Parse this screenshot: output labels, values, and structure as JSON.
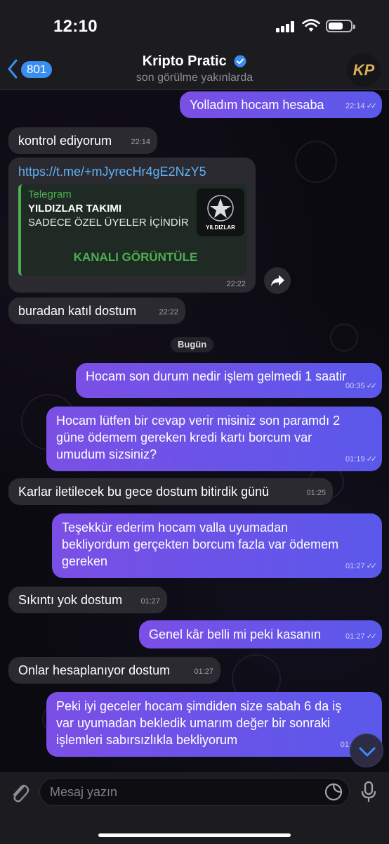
{
  "status_bar": {
    "time": "12:10"
  },
  "header": {
    "back_count": "801",
    "title": "Kripto Pratic",
    "subtitle": "son görülme yakınlarda",
    "avatar_text": "KP"
  },
  "messages": [
    {
      "dir": "out",
      "text": "Yolladım hocam hesaba",
      "time": "22:14"
    },
    {
      "dir": "in",
      "text": "kontrol ediyorum",
      "time": "22:14"
    },
    {
      "dir": "in",
      "text": "buradan katıl dostum",
      "time": "22:22"
    },
    {
      "dir": "out",
      "text": "Hocam son durum nedir işlem gelmedi 1 saatir",
      "time": "00:35"
    },
    {
      "dir": "out",
      "text": "Hocam lütfen bir cevap verir misiniz son paramdı 2 güne ödemem gereken kredi kartı borcum var umudum sizsiniz?",
      "time": "01:19"
    },
    {
      "dir": "in",
      "text": "Karlar iletilecek bu gece dostum bitirdik günü",
      "time": "01:25"
    },
    {
      "dir": "out",
      "text": "Teşekkür ederim hocam valla uyumadan bekliyordum gerçekten borcum fazla var ödemem gereken",
      "time": "01:27"
    },
    {
      "dir": "in",
      "text": "Sıkıntı yok dostum",
      "time": "01:27"
    },
    {
      "dir": "out",
      "text": "Genel kâr belli mi peki kasanın",
      "time": "01:27"
    },
    {
      "dir": "in",
      "text": "Onlar hesaplanıyor dostum",
      "time": "01:27"
    },
    {
      "dir": "out",
      "text": "Peki iyi geceler hocam şimdiden size sabah 6 da iş var uyumadan bekledik umarım değer bir sonraki işlemleri sabırsızlıkla bekliyorum",
      "time": "01:"
    }
  ],
  "link_message": {
    "url": "https://t.me/+mJyrecHr4gE2NzY5",
    "site": "Telegram",
    "title": "YILDIZLAR TAKIMI",
    "description": "SADECE ÖZEL ÜYELER İÇİNDİR",
    "thumb_label": "YILDIZLAR",
    "button": "KANALI GÖRÜNTÜLE",
    "time": "22:22"
  },
  "date_separator": "Bugün",
  "input": {
    "placeholder": "Mesaj yazın"
  },
  "colors": {
    "accent": "#3a8ef0",
    "outgoing_start": "#7b4fe6",
    "outgoing_end": "#5a58ea",
    "incoming": "#2b2a30",
    "link": "#5fb0f5",
    "preview": "#4caf50"
  },
  "icons": [
    "back-chevron-icon",
    "verified-icon",
    "share-icon",
    "attach-icon",
    "sticker-icon",
    "mic-icon",
    "chevron-down-icon"
  ]
}
